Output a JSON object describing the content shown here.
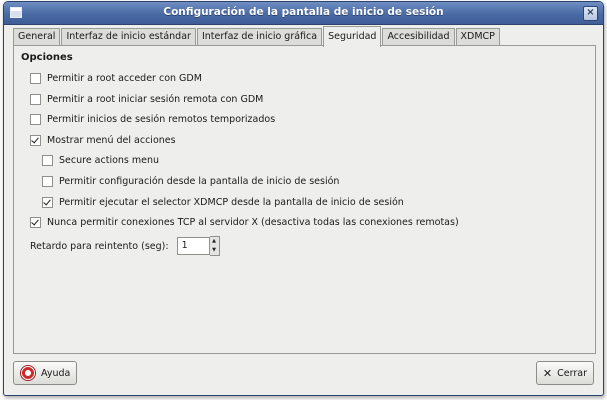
{
  "window": {
    "title": "Configuración de la pantalla de inicio de sesión",
    "close_glyph": "×"
  },
  "tabs": [
    {
      "label": "General"
    },
    {
      "label": "Interfaz de inicio estándar"
    },
    {
      "label": "Interfaz de inicio gráfica"
    },
    {
      "label": "Seguridad",
      "active": true
    },
    {
      "label": "Accesibilidad"
    },
    {
      "label": "XDMCP"
    }
  ],
  "section": {
    "title": "Opciones"
  },
  "options": [
    {
      "label": "Permitir a root acceder con GDM",
      "checked": false
    },
    {
      "label": "Permitir a root iniciar sesión remota con GDM",
      "checked": false
    },
    {
      "label": "Permitir inicios de sesión remotos temporizados",
      "checked": false
    },
    {
      "label": "Mostrar menú del acciones",
      "checked": true
    },
    {
      "label": "Secure actions menu",
      "checked": false
    },
    {
      "label": "Permitir configuración desde la pantalla de inicio de sesión",
      "checked": false
    },
    {
      "label": "Permitir ejecutar el selector XDMCP desde la pantalla de inicio de sesión",
      "checked": true
    },
    {
      "label": "Nunca permitir conexiones TCP al servidor X (desactiva todas las conexiones remotas)",
      "checked": true
    }
  ],
  "retry": {
    "label": "Retardo para reintento (seg):",
    "value": "1",
    "up": "▲",
    "down": "▼"
  },
  "buttons": {
    "help": "Ayuda",
    "close": "Cerrar",
    "close_glyph": "✕"
  },
  "icons": {
    "help": "help-lifebuoy-icon",
    "close": "close-x-icon",
    "window_menu": "window-menu-icon"
  },
  "colors": {
    "titlebar": "#4a6aa5",
    "background": "#eeeeec"
  }
}
